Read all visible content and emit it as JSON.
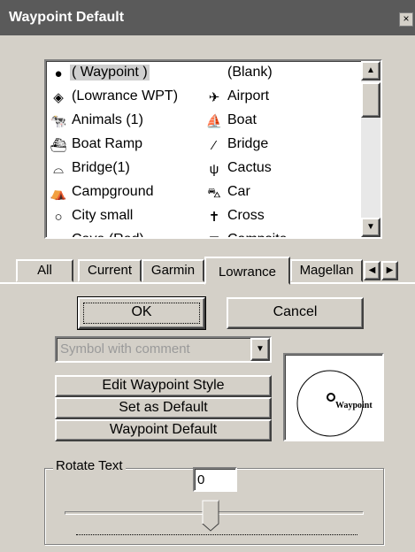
{
  "window": {
    "title": "Waypoint Default",
    "close_glyph": "×"
  },
  "symbol_list": {
    "left_column": [
      {
        "label": "( Waypoint )",
        "icon": "waypoint-dot-icon",
        "glyph": "●",
        "selected": true
      },
      {
        "label": "(Lowrance WPT)",
        "icon": "lowrance-diamond-icon",
        "glyph": "◈"
      },
      {
        "label": "Animals (1)",
        "icon": "animal-icon",
        "glyph": "🐄"
      },
      {
        "label": "Boat Ramp",
        "icon": "boat-ramp-icon",
        "glyph": "⛴"
      },
      {
        "label": "Bridge(1)",
        "icon": "bridge-icon",
        "glyph": "⌓"
      },
      {
        "label": "Campground",
        "icon": "campground-icon",
        "glyph": "⛺"
      },
      {
        "label": "City small",
        "icon": "city-small-icon",
        "glyph": "○"
      },
      {
        "label": "Cave (Red)",
        "icon": "partial-icon",
        "glyph": "●"
      }
    ],
    "right_column": [
      {
        "label": "(Blank)",
        "icon": "blank-icon",
        "glyph": ""
      },
      {
        "label": "Airport",
        "icon": "airport-icon",
        "glyph": "✈"
      },
      {
        "label": "Boat",
        "icon": "boat-icon",
        "glyph": "⛵"
      },
      {
        "label": "Bridge",
        "icon": "bridge-icon",
        "glyph": "⁄"
      },
      {
        "label": "Cactus",
        "icon": "cactus-icon",
        "glyph": "ψ"
      },
      {
        "label": "Car",
        "icon": "car-icon",
        "glyph": "⛍"
      },
      {
        "label": "Cross",
        "icon": "cross-icon",
        "glyph": "✝"
      },
      {
        "label": "Campsite",
        "icon": "partial-icon",
        "glyph": "⊞"
      }
    ]
  },
  "tabs": [
    {
      "label": "All"
    },
    {
      "label": "Current"
    },
    {
      "label": "Garmin"
    },
    {
      "label": "Lowrance",
      "active": true
    },
    {
      "label": "Magellan"
    }
  ],
  "tab_arrows": {
    "left": "◀",
    "right": "▶"
  },
  "buttons": {
    "ok": "OK",
    "cancel": "Cancel",
    "edit_style": "Edit Waypoint Style",
    "set_default": "Set as Default",
    "waypoint_default": "Waypoint Default"
  },
  "display_combo": {
    "value": "Symbol with comment"
  },
  "preview": {
    "label": "Waypoint"
  },
  "rotate_text": {
    "group_label": "Rotate Text",
    "value": "0",
    "slider_fraction": 0.5
  },
  "scroll_glyphs": {
    "up": "▲",
    "down": "▼",
    "dropdown": "▼"
  }
}
